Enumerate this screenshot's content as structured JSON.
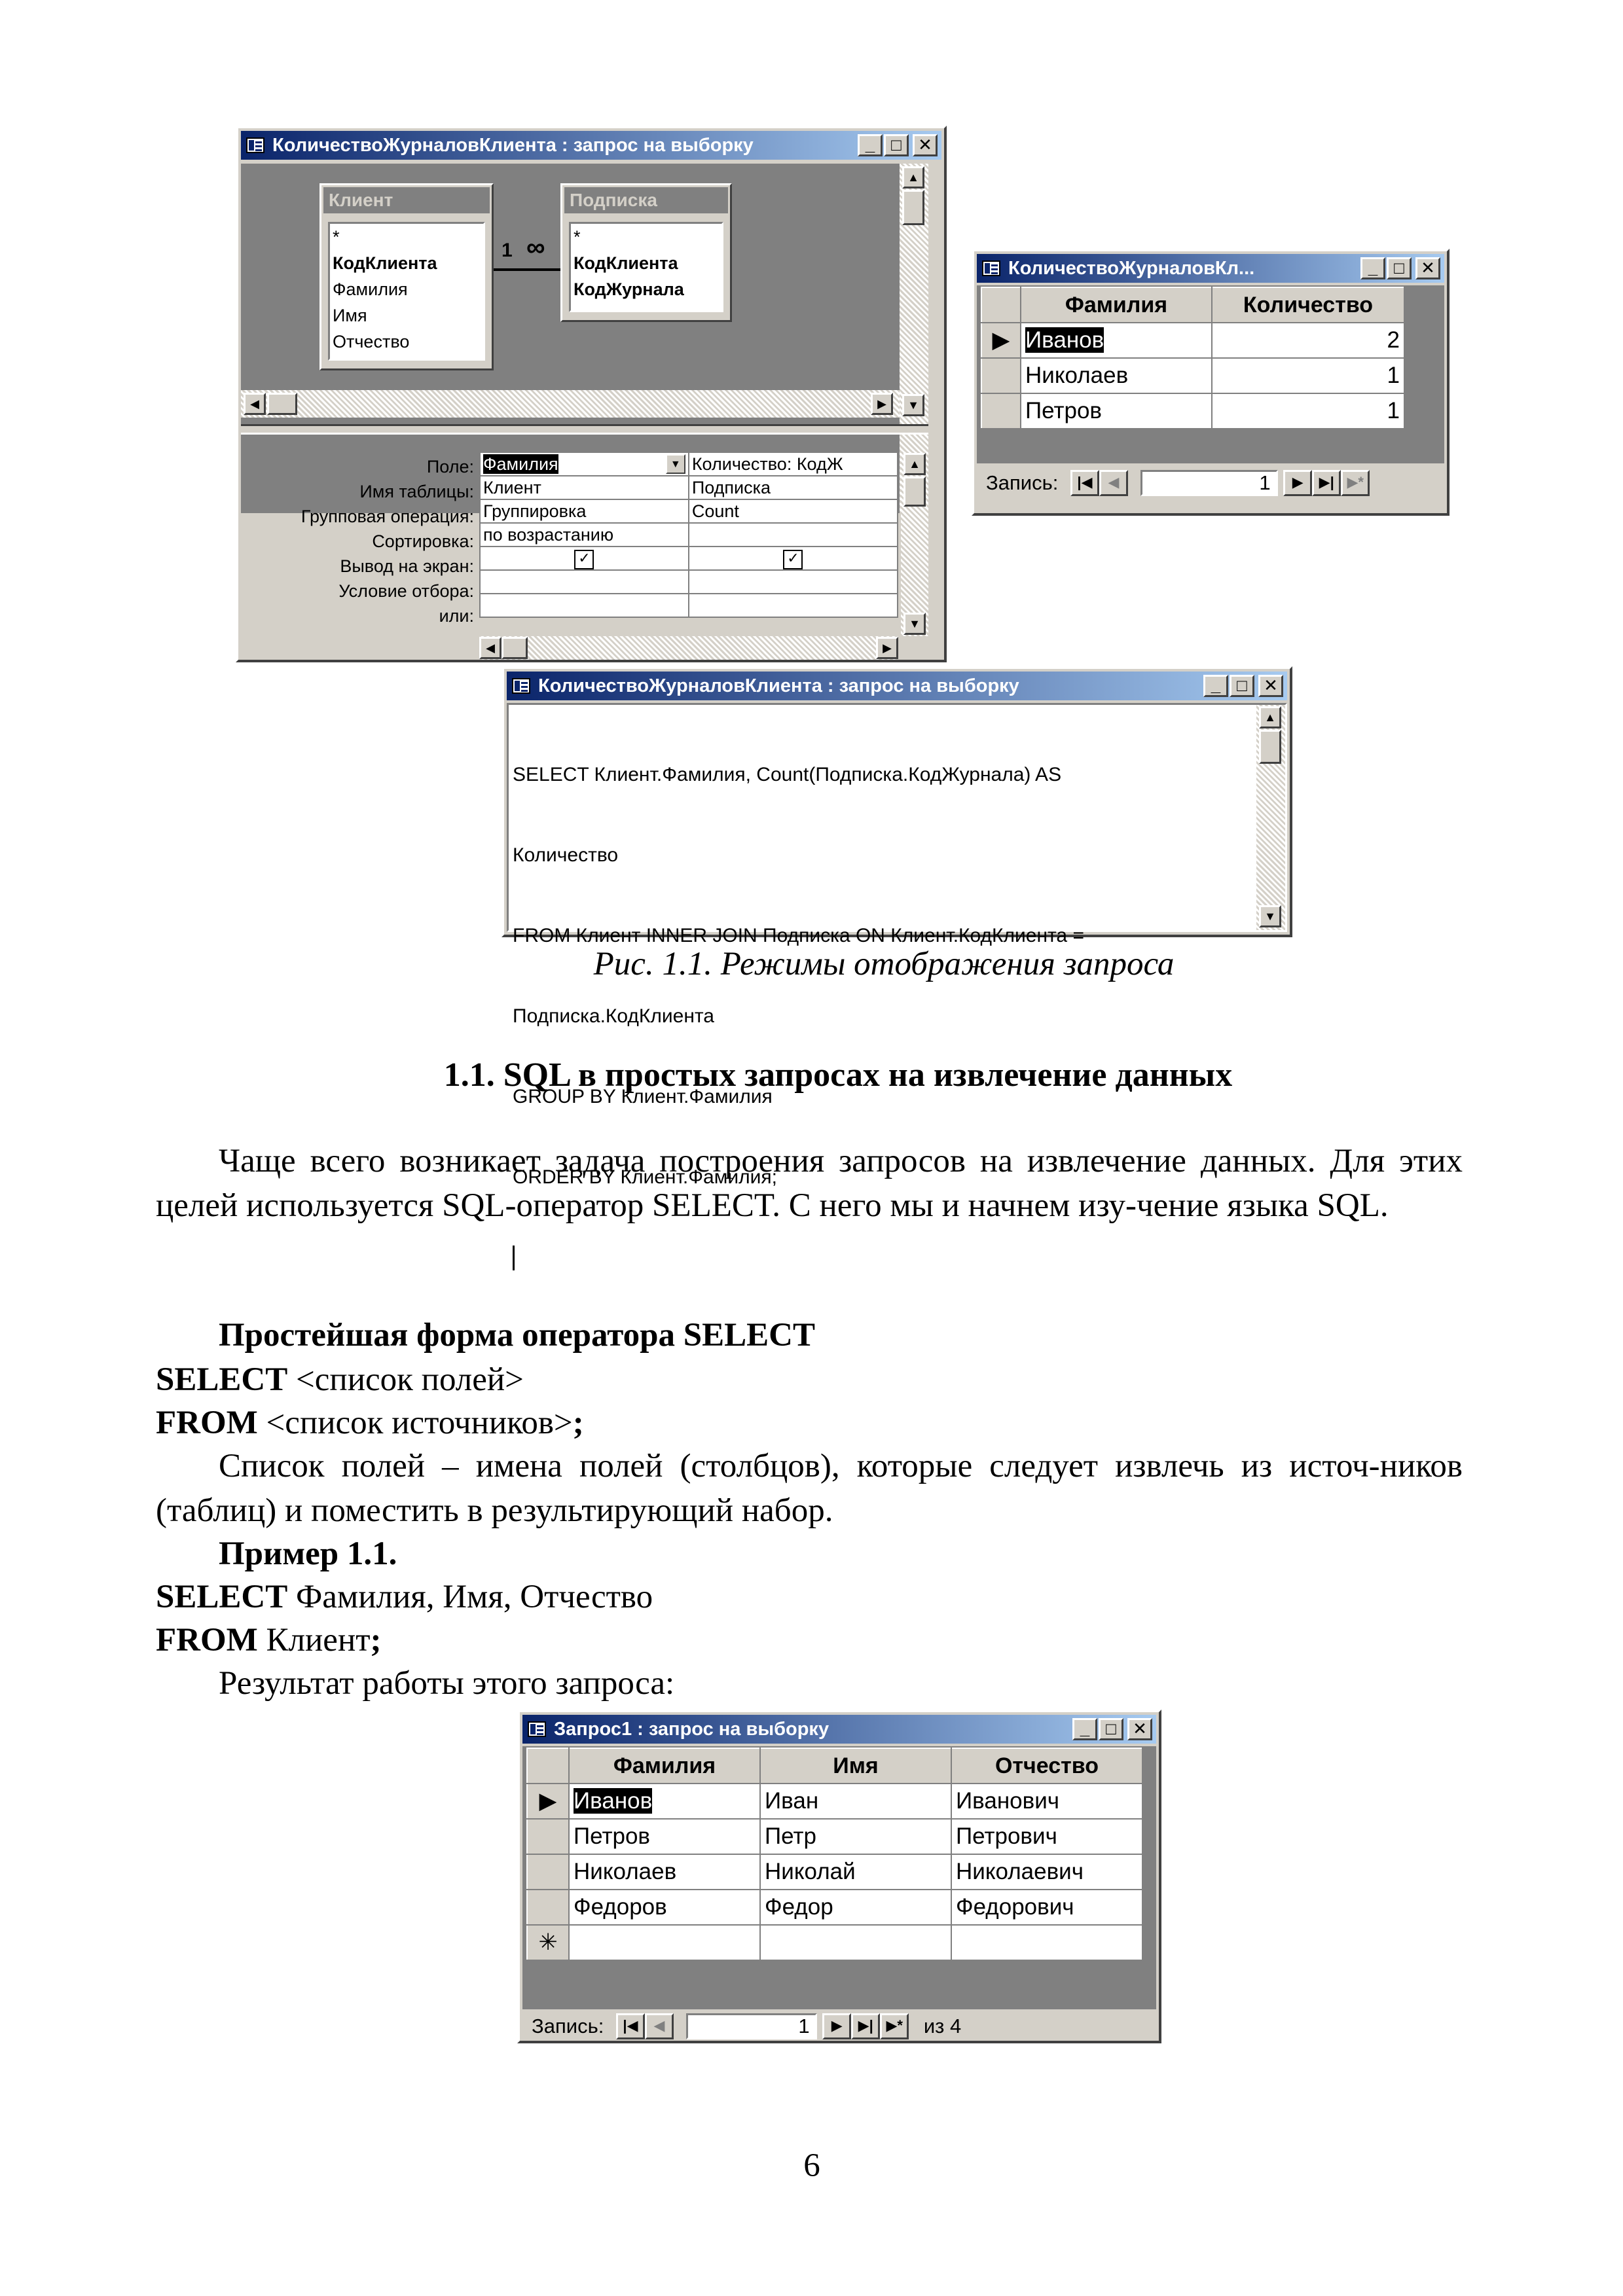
{
  "window_design": {
    "title": "КоличествоЖурналовКлиента : запрос на выборку",
    "table_client": {
      "name": "Клиент",
      "fields": [
        "*",
        "КодКлиента",
        "Фамилия",
        "Имя",
        "Отчество"
      ]
    },
    "table_subscription": {
      "name": "Подписка",
      "fields": [
        "*",
        "КодКлиента",
        "КодЖурнала"
      ]
    },
    "join_one": "1",
    "join_many": "∞",
    "grid_labels": [
      "Поле:",
      "Имя таблицы:",
      "Групповая операция:",
      "Сортировка:",
      "Вывод на экран:",
      "Условие отбора:",
      "или:"
    ],
    "col1": {
      "field": "Фамилия",
      "table": "Клиент",
      "group": "Группировка",
      "sort": "по возрастанию"
    },
    "col2": {
      "field": "Количество: КодЖ",
      "table": "Подписка",
      "group": "Count",
      "sort": ""
    }
  },
  "window_result_small": {
    "title": "КоличествоЖурналовКл...",
    "columns": [
      "Фамилия",
      "Количество"
    ],
    "rows": [
      [
        "Иванов",
        "2"
      ],
      [
        "Николаев",
        "1"
      ],
      [
        "Петров",
        "1"
      ]
    ],
    "record_label": "Запись:",
    "record_value": "1"
  },
  "window_sql": {
    "title": "КоличествоЖурналовКлиента : запрос на выборку",
    "lines": [
      "SELECT Клиент.Фамилия, Count(Подписка.КодЖурнала) AS",
      "Количество",
      "FROM Клиент INNER JOIN Подписка ON Клиент.КодКлиента =",
      "Подписка.КодКлиента",
      "GROUP BY Клиент.Фамилия",
      "ORDER BY Клиент.Фамилия;"
    ]
  },
  "caption": "Рис. 1.1. Режимы отображения запроса",
  "heading": "1.1. SQL в простых запросах на извлечение данных",
  "para1": "Чаще всего возникает задача построения запросов на извлечение данных. Для этих целей используется SQL-оператор SELECT. С него мы и начнем изу-чение языка SQL.",
  "form_title": "Простейшая форма оператора SELECT",
  "kw_select": "SELECT",
  "kw_from": "FROM",
  "syntax_select_rest": " <список полей>",
  "syntax_from_rest": " <список источников>",
  "semicolon": ";",
  "para2": "Список полей – имена полей (столбцов), которые следует извлечь из источ-ников (таблиц) и поместить в результирующий набор.",
  "example_title": "Пример 1.1.",
  "example_select_rest": " Фамилия, Имя, Отчество",
  "example_from_rest": " Клиент",
  "result_intro": "Результат работы этого запроса:",
  "window_query1": {
    "title": "Запрос1 : запрос на выборку",
    "columns": [
      "Фамилия",
      "Имя",
      "Отчество"
    ],
    "rows": [
      [
        "Иванов",
        "Иван",
        "Иванович"
      ],
      [
        "Петров",
        "Петр",
        "Петрович"
      ],
      [
        "Николаев",
        "Николай",
        "Николаевич"
      ],
      [
        "Федоров",
        "Федор",
        "Федорович"
      ]
    ],
    "record_label": "Запись:",
    "record_value": "1",
    "record_total": "из 4"
  },
  "page_number": "6"
}
